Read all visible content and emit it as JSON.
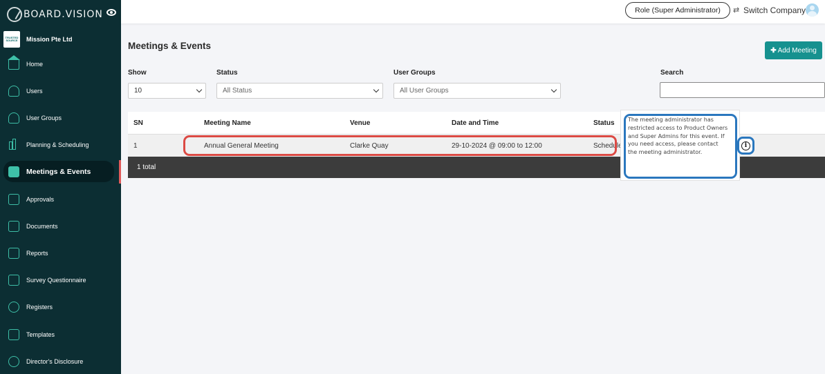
{
  "brand": {
    "name": "BOARD.VISION"
  },
  "organization": {
    "name": "Mission Pte Ltd",
    "logo_text": "TRUSTED SOURCE"
  },
  "sidebar": {
    "items": [
      {
        "label": "Home",
        "icon": "home-icon"
      },
      {
        "label": "Users",
        "icon": "user-icon"
      },
      {
        "label": "User Groups",
        "icon": "user-groups-icon"
      },
      {
        "label": "Planning & Scheduling",
        "icon": "bar-chart-icon"
      },
      {
        "label": "Meetings & Events",
        "icon": "calendar-icon",
        "active": true
      },
      {
        "label": "Approvals",
        "icon": "approvals-icon"
      },
      {
        "label": "Documents",
        "icon": "documents-icon"
      },
      {
        "label": "Reports",
        "icon": "reports-icon"
      },
      {
        "label": "Survey Questionnaire",
        "icon": "survey-icon"
      },
      {
        "label": "Registers",
        "icon": "registered-icon"
      },
      {
        "label": "Templates",
        "icon": "templates-icon"
      },
      {
        "label": "Director's Disclosure",
        "icon": "disclosure-icon"
      }
    ]
  },
  "topbar": {
    "role": "Role (Super Administrator)",
    "switch_company": "Switch Company"
  },
  "page": {
    "title": "Meetings & Events",
    "add_button": "Add Meeting"
  },
  "filters": {
    "show": {
      "label": "Show",
      "value": "10"
    },
    "status": {
      "label": "Status",
      "value": "All Status"
    },
    "user_groups": {
      "label": "User Groups",
      "value": "All User Groups"
    },
    "search": {
      "label": "Search",
      "value": ""
    }
  },
  "table": {
    "columns": [
      "SN",
      "Meeting Name",
      "Venue",
      "Date and Time",
      "Status"
    ],
    "rows": [
      {
        "sn": "1",
        "meeting_name": "Annual General Meeting",
        "venue": "Clarke Quay",
        "date_time": "29-10-2024 @ 09:00 to 12:00",
        "status": "Scheduled"
      }
    ],
    "footer": "1 total"
  },
  "tooltip": {
    "text": "The meeting administrator has restricted access to Product Owners and Super Admins for this event. If you need access, please contact the meeting administrator."
  },
  "colors": {
    "sidebar_bg": "#0c2e33",
    "accent": "#16918f",
    "highlight_red": "#dc4a44",
    "highlight_blue": "#2a77be"
  }
}
